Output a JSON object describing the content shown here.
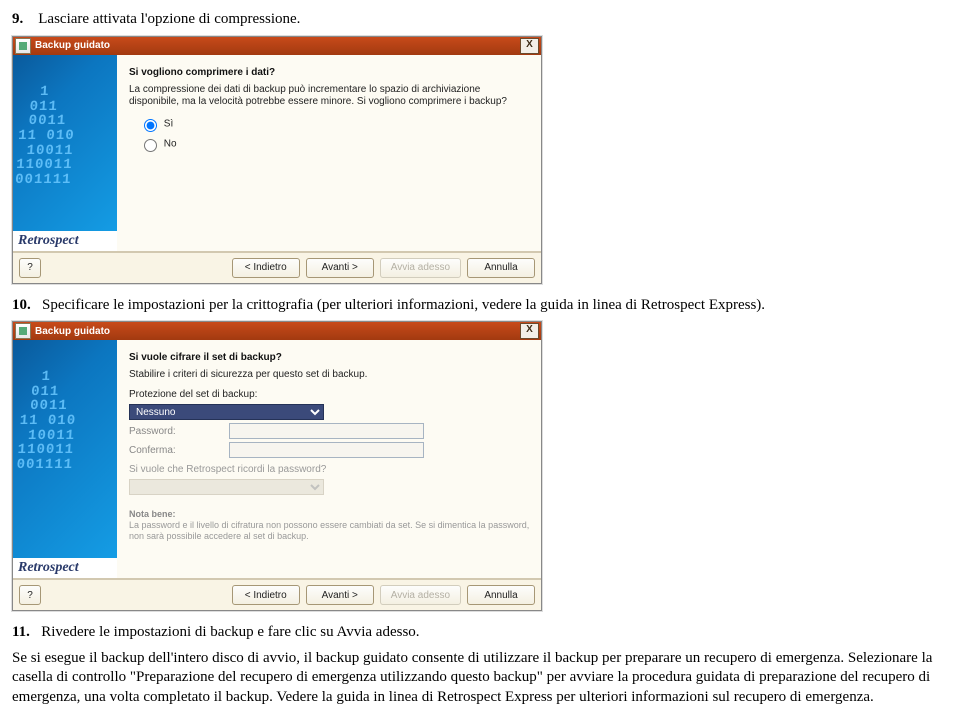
{
  "step9": {
    "num": "9.",
    "text": "Lasciare attivata l'opzione di compressione."
  },
  "dlg1": {
    "title": "Backup guidato",
    "close_label": "X",
    "brand": "Retrospect",
    "digits": "  1\n 011\n 0011\n11 010\n 10011\n110011\n001111",
    "question": "Si vogliono comprimere i dati?",
    "desc": "La compressione dei dati di backup può incrementare lo spazio di archiviazione disponibile, ma la velocità potrebbe essere minore. Si vogliono comprimere i backup?",
    "opt_yes": "Sì",
    "opt_no": "No",
    "btn_help": "?",
    "btn_back": "< Indietro",
    "btn_next": "Avanti >",
    "btn_now": "Avvia adesso",
    "btn_cancel": "Annulla"
  },
  "step10": {
    "num": "10.",
    "text": "Specificare le impostazioni per la crittografia (per ulteriori informazioni, vedere la guida in linea di Retrospect Express)."
  },
  "dlg2": {
    "title": "Backup guidato",
    "close_label": "X",
    "brand": "Retrospect",
    "digits": "  1\n 011\n 0011\n11 010\n 10011\n110011\n001111",
    "question": "Si vuole cifrare il set di backup?",
    "line1": "Stabilire i criteri di sicurezza per questo set di backup.",
    "line2": "Protezione del set di backup:",
    "select_value": "Nessuno",
    "lbl_password": "Password:",
    "lbl_confirm": "Conferma:",
    "lbl_remember": "Si vuole che Retrospect ricordi la password?",
    "note_head": "Nota bene:",
    "note_body": "La password e il livello di cifratura non possono essere cambiati da set. Se si dimentica la password, non sarà possibile accedere al set di backup.",
    "btn_help": "?",
    "btn_back": "< Indietro",
    "btn_next": "Avanti >",
    "btn_now": "Avvia adesso",
    "btn_cancel": "Annulla"
  },
  "step11": {
    "num": "11.",
    "lead": "Rivedere le impostazioni di backup e fare clic su Avvia adesso.",
    "body": "Se si esegue il backup dell'intero disco di avvio, il backup guidato consente di utilizzare il backup per preparare un recupero di emergenza. Selezionare la casella di controllo \"Preparazione del recupero di emergenza utilizzando questo backup\" per avviare la procedura guidata di preparazione del recupero di emergenza, una volta completato il backup. Vedere la guida in linea di Retrospect Express per ulteriori informazioni sul recupero di emergenza."
  }
}
